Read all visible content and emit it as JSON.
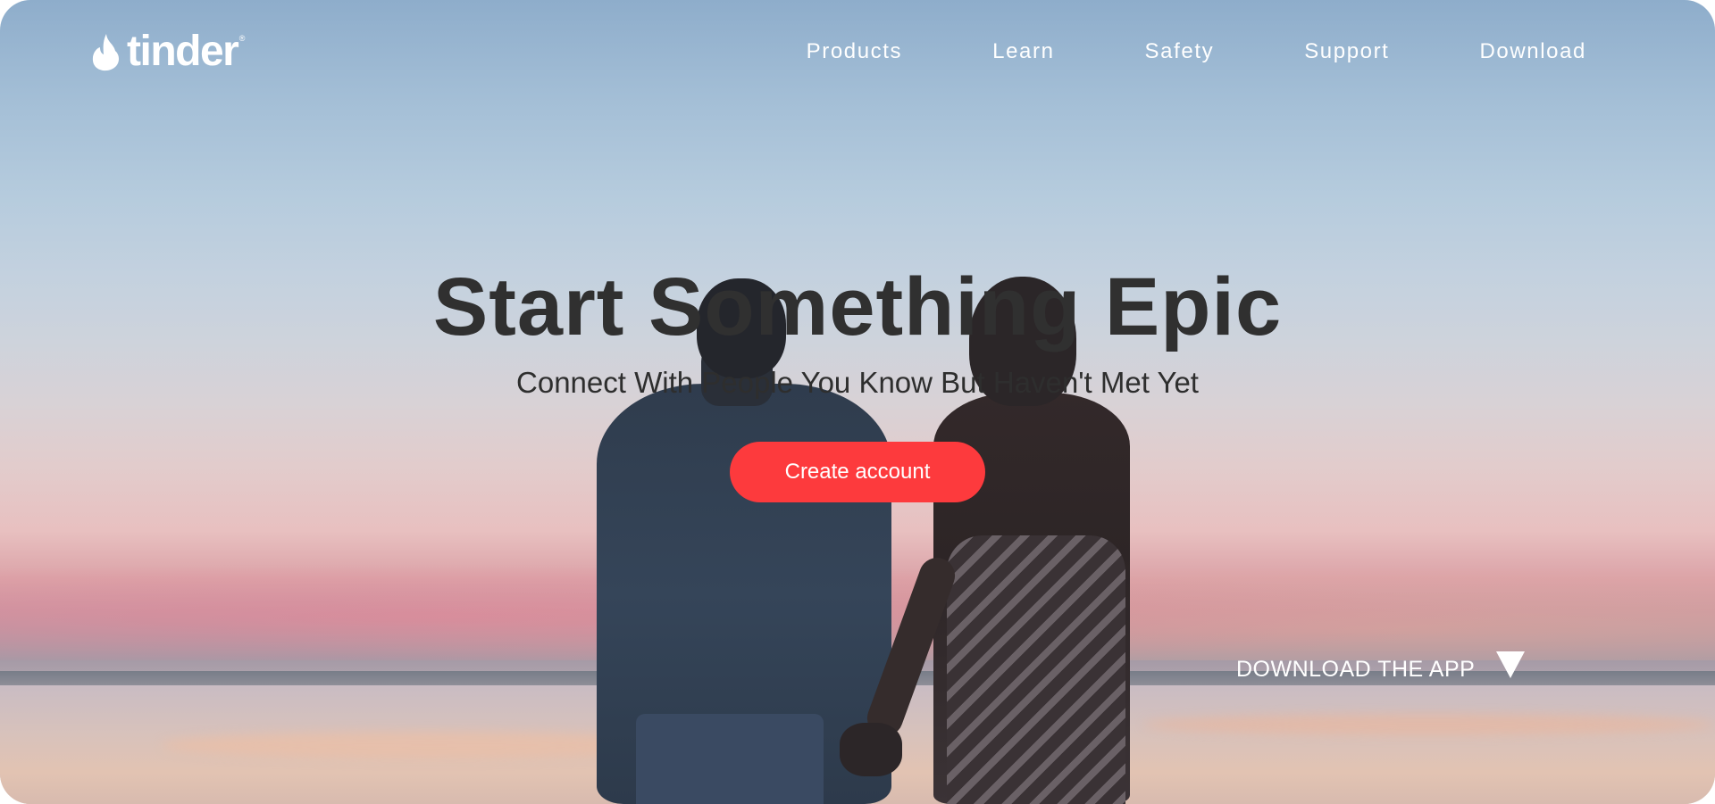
{
  "header": {
    "logo_text": "tinder",
    "logo_mark": "®",
    "nav": [
      {
        "label": "Products"
      },
      {
        "label": "Learn"
      },
      {
        "label": "Safety"
      },
      {
        "label": "Support"
      },
      {
        "label": "Download"
      }
    ]
  },
  "hero": {
    "title": "Start Something Epic",
    "subtitle": "Connect With People You Know But Haven't Met Yet",
    "cta_label": "Create account",
    "download_label": "DOWNLOAD THE APP",
    "download_icon": "triangle-down-icon",
    "background": "couple-silhouette-at-sunset"
  },
  "colors": {
    "brand_red": "#fd3a3d",
    "title_text": "#303030",
    "nav_text": "#ffffff"
  }
}
